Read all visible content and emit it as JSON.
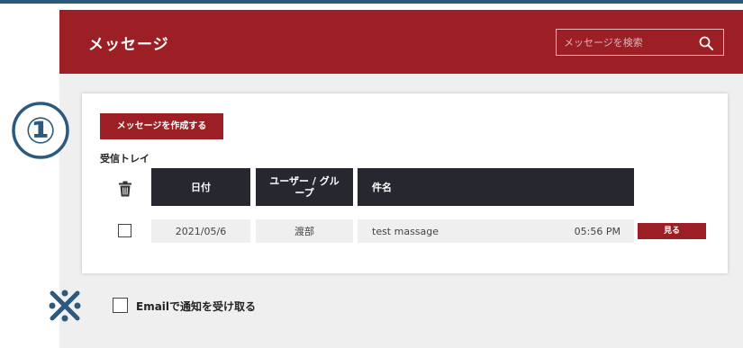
{
  "header": {
    "title": "メッセージ",
    "search_placeholder": "メッセージを検索"
  },
  "card": {
    "compose_button": "メッセージを作成する",
    "inbox_label": "受信トレイ",
    "table": {
      "columns": [
        "日付",
        "ユーザー / グル ープ",
        "件名"
      ],
      "rows": [
        {
          "date": "2021/05/6",
          "user": "渡部",
          "subject": "test massage",
          "time": "05:56 PM",
          "view_label": "見る"
        }
      ]
    }
  },
  "annotations": {
    "circled_number": "①",
    "note_mark": "※"
  },
  "notification": {
    "label": "Emailで通知を受け取る"
  },
  "colors": {
    "brand": "#9c1f26",
    "header_cell": "#27272f",
    "annotation_blue": "#2c5a7e"
  }
}
